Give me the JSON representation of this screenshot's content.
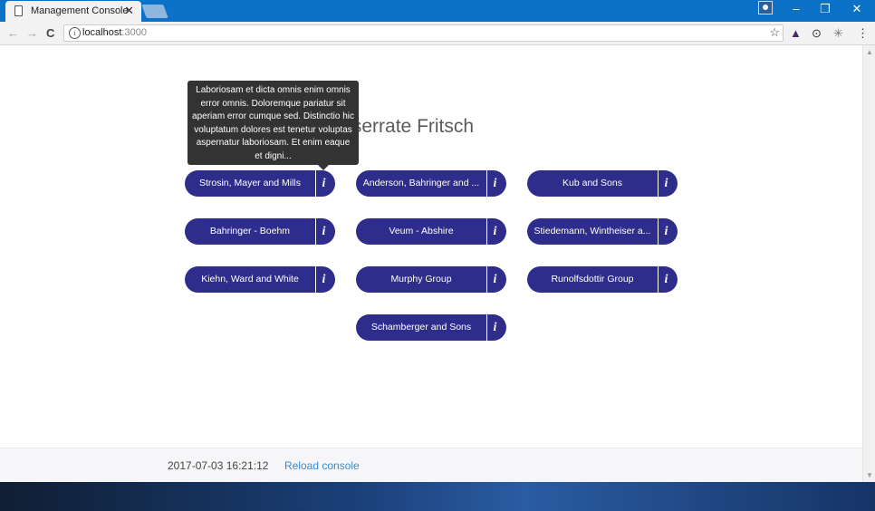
{
  "browser": {
    "tab_title": "Management Console",
    "tab_close": "✕",
    "url_host": "localhost",
    "url_port": ":3000",
    "back": "←",
    "forward": "→",
    "reload": "C",
    "star": "☆",
    "minimize": "–",
    "restore": "❐",
    "close": "✕"
  },
  "page": {
    "heading": "ent Monserrate Fritsch",
    "tooltip": "Laboriosam et dicta omnis enim omnis error omnis. Doloremque pariatur sit aperiam error cumque sed. Distinctio hic voluptatum dolores est tenetur voluptas aspernatur laboriosam. Et enim eaque et digni...",
    "info_label": "i",
    "companies": [
      "Strosin, Mayer and Mills",
      "Anderson, Bahringer and ...",
      "Kub and Sons",
      "Bahringer - Boehm",
      "Veum - Abshire",
      "Stiedemann, Wintheiser a...",
      "Kiehn, Ward and White",
      "Murphy Group",
      "Runolfsdottir Group",
      "Schamberger and Sons"
    ]
  },
  "footer": {
    "timestamp": "2017-07-03 16:21:12",
    "reload_link": "Reload console"
  },
  "colors": {
    "button": "#2f2d8c",
    "link": "#3d8bc9",
    "titlebar": "#0b72c7"
  }
}
